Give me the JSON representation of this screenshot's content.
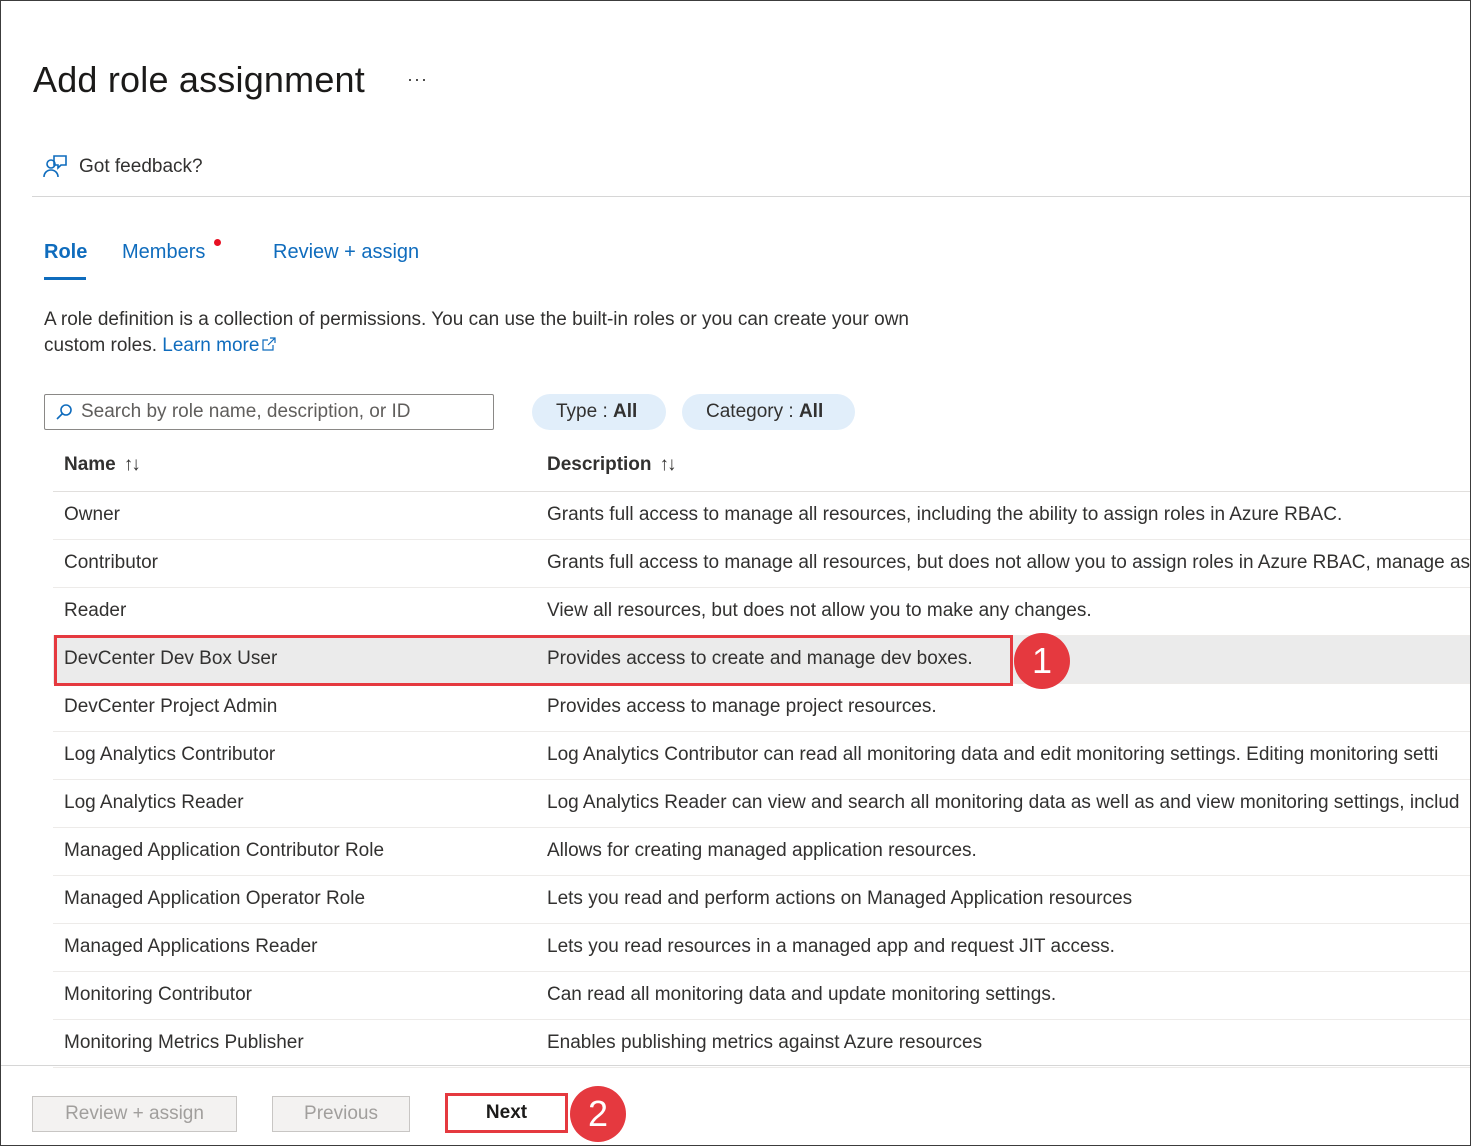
{
  "header": {
    "title": "Add role assignment",
    "more_label": "···",
    "feedback_label": "Got feedback?"
  },
  "tabs": [
    {
      "label": "Role",
      "active": true
    },
    {
      "label": "Members",
      "has_dot": true
    },
    {
      "label": "Review + assign"
    }
  ],
  "description": {
    "text": "A role definition is a collection of permissions. You can use the built-in roles or you can create your own custom roles.",
    "link_label": "Learn more"
  },
  "search": {
    "placeholder": "Search by role name, description, or ID",
    "value": ""
  },
  "filters": {
    "type_label": "Type : ",
    "type_value": "All",
    "category_label": "Category : ",
    "category_value": "All"
  },
  "table": {
    "columns": [
      {
        "label": "Name",
        "sort_icon": "↑↓"
      },
      {
        "label": "Description",
        "sort_icon": "↑↓"
      }
    ],
    "rows": [
      {
        "name": "Owner",
        "description": "Grants full access to manage all resources, including the ability to assign roles in Azure RBAC."
      },
      {
        "name": "Contributor",
        "description": "Grants full access to manage all resources, but does not allow you to assign roles in Azure RBAC, manage as"
      },
      {
        "name": "Reader",
        "description": "View all resources, but does not allow you to make any changes."
      },
      {
        "name": "DevCenter Dev Box User",
        "description": "Provides access to create and manage dev boxes.",
        "selected": true
      },
      {
        "name": "DevCenter Project Admin",
        "description": "Provides access to manage project resources."
      },
      {
        "name": "Log Analytics Contributor",
        "description": "Log Analytics Contributor can read all monitoring data and edit monitoring settings. Editing monitoring setti"
      },
      {
        "name": "Log Analytics Reader",
        "description": "Log Analytics Reader can view and search all monitoring data as well as and view monitoring settings, includ"
      },
      {
        "name": "Managed Application Contributor Role",
        "description": "Allows for creating managed application resources."
      },
      {
        "name": "Managed Application Operator Role",
        "description": "Lets you read and perform actions on Managed Application resources"
      },
      {
        "name": "Managed Applications Reader",
        "description": "Lets you read resources in a managed app and request JIT access."
      },
      {
        "name": "Monitoring Contributor",
        "description": "Can read all monitoring data and update monitoring settings."
      },
      {
        "name": "Monitoring Metrics Publisher",
        "description": "Enables publishing metrics against Azure resources"
      }
    ]
  },
  "callouts": {
    "step1": "1",
    "step2": "2"
  },
  "footer": {
    "review_assign_label": "Review + assign",
    "previous_label": "Previous",
    "next_label": "Next"
  },
  "colors": {
    "accent": "#0f6cbd",
    "callout": "#e5393f",
    "pill_bg": "#e1eefa",
    "selected_row": "#ebebeb"
  }
}
